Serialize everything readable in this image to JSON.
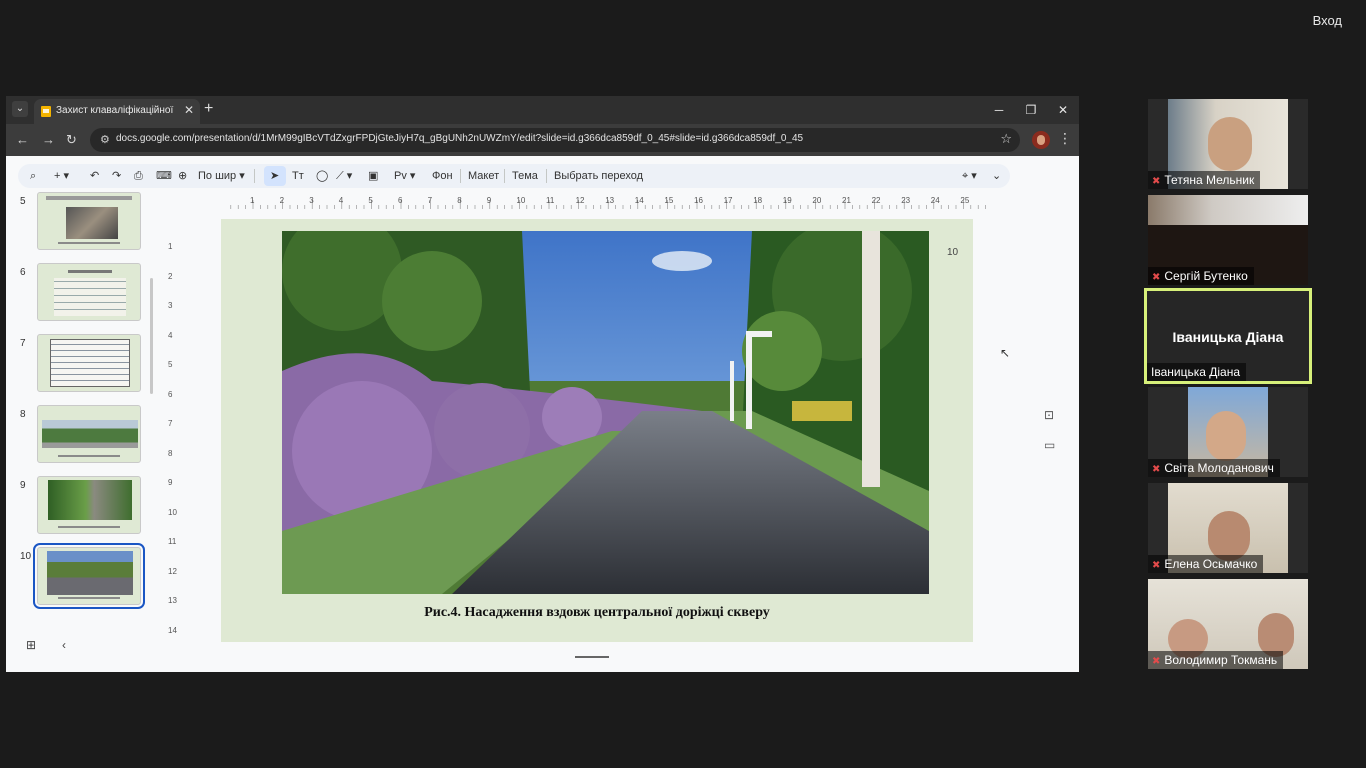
{
  "top": {
    "login_label": "Вход"
  },
  "browser": {
    "tab_title": "Захист клаваліфікаційної робо",
    "url": "docs.google.com/presentation/d/1MrM99gIBcVTdZxgrFPDjGteJiyH7q_gBgUNh2nUWZmY/edit?slide=id.g366dca859df_0_45#slide=id.g366dca859df_0_45",
    "icons": {
      "dropdown": "chevron-down-icon",
      "close": "close-icon",
      "new_tab": "plus-icon",
      "back": "arrow-left-icon",
      "forward": "arrow-right-icon",
      "reload": "reload-icon",
      "star": "star-icon",
      "menu": "kebab-menu-icon"
    },
    "controls": {
      "minimize": "─",
      "maximize": "❐",
      "close": "✕"
    }
  },
  "toolbar": {
    "zoom_label": "По шир",
    "background_label": "Фон",
    "layout_label": "Макет",
    "theme_label": "Тема",
    "transition_label": "Выбрать переход"
  },
  "filmstrip": {
    "slides": [
      {
        "number": "5"
      },
      {
        "number": "6"
      },
      {
        "number": "7"
      },
      {
        "number": "8"
      },
      {
        "number": "9"
      },
      {
        "number": "10"
      }
    ],
    "active_slide": "10"
  },
  "ruler": {
    "top": [
      "1",
      "2",
      "3",
      "4",
      "5",
      "6",
      "7",
      "8",
      "9",
      "10",
      "11",
      "12",
      "13",
      "14",
      "15",
      "16",
      "17",
      "18",
      "19",
      "20",
      "21",
      "22",
      "23",
      "24",
      "25"
    ],
    "left": [
      "1",
      "2",
      "3",
      "4",
      "5",
      "6",
      "7",
      "8",
      "9",
      "10",
      "11",
      "12",
      "13",
      "14"
    ]
  },
  "slide": {
    "number": "10",
    "caption": "Рис.4. Насадження вздовж центральної доріжці скверу"
  },
  "participants": [
    {
      "name": "Тетяна Мельник",
      "muted": true
    },
    {
      "name": "Сергій Бутенко",
      "muted": true
    },
    {
      "name": "Іваницька Діана",
      "muted": false,
      "speaking": true
    },
    {
      "name": "Світа Молоданович",
      "muted": true
    },
    {
      "name": "Елена Осьмачко",
      "muted": true
    },
    {
      "name": "Володимир Токмань",
      "muted": true
    }
  ],
  "colors": {
    "speaker_border": "#d7f07a",
    "muted_icon": "#e24b4b",
    "slide_bg": "#dfe9d3",
    "active_thumb": "#1a56c4"
  }
}
